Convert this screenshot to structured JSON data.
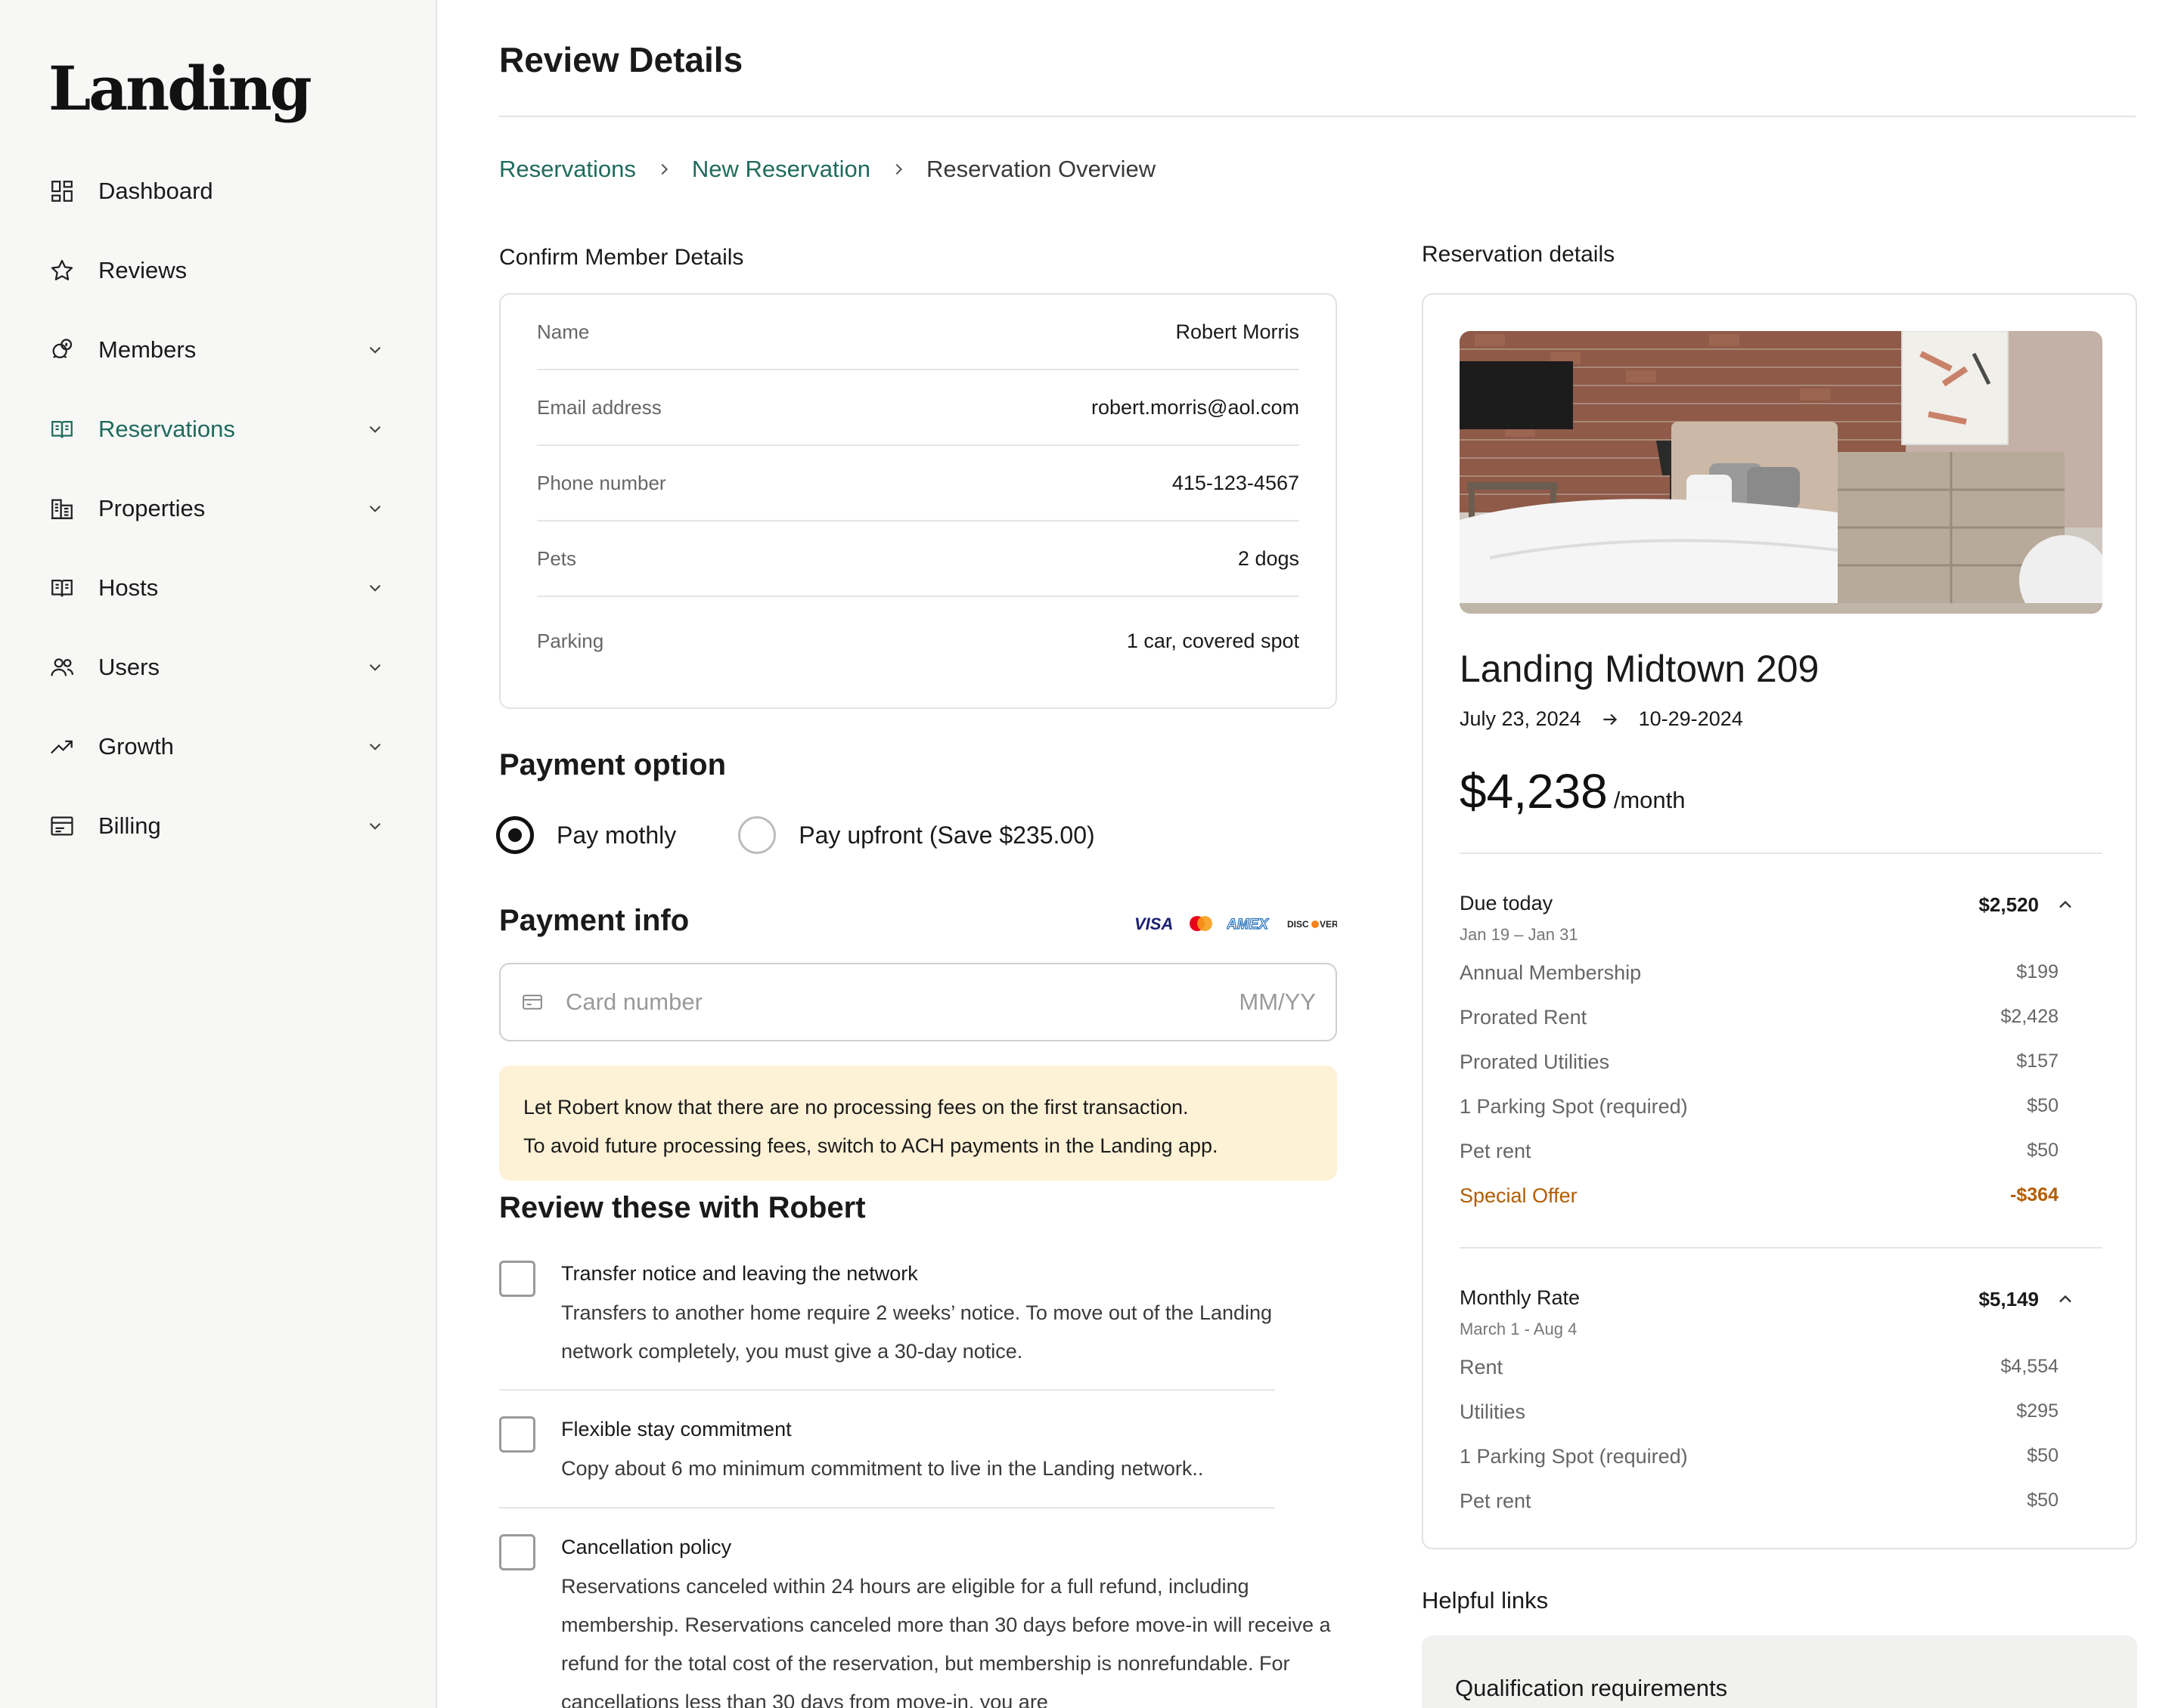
{
  "brand": {
    "logo_text": "Landing"
  },
  "sidebar": {
    "items": [
      {
        "label": "Dashboard",
        "icon": "dashboard-icon",
        "has_chevron": false,
        "active": false
      },
      {
        "label": "Reviews",
        "icon": "star-icon",
        "has_chevron": false,
        "active": false
      },
      {
        "label": "Members",
        "icon": "members-icon",
        "has_chevron": true,
        "active": false
      },
      {
        "label": "Reservations",
        "icon": "reservations-icon",
        "has_chevron": true,
        "active": true
      },
      {
        "label": "Properties",
        "icon": "building-icon",
        "has_chevron": true,
        "active": false
      },
      {
        "label": "Hosts",
        "icon": "hosts-icon",
        "has_chevron": true,
        "active": false
      },
      {
        "label": "Users",
        "icon": "users-icon",
        "has_chevron": true,
        "active": false
      },
      {
        "label": "Growth",
        "icon": "trend-icon",
        "has_chevron": true,
        "active": false
      },
      {
        "label": "Billing",
        "icon": "billing-icon",
        "has_chevron": true,
        "active": false
      }
    ]
  },
  "header": {
    "title": "Review Details"
  },
  "breadcrumb": {
    "items": [
      {
        "label": "Reservations",
        "link": true
      },
      {
        "label": "New Reservation",
        "link": true
      },
      {
        "label": "Reservation Overview",
        "link": false
      }
    ]
  },
  "member": {
    "section_title": "Confirm Member Details",
    "rows": [
      {
        "key": "Name",
        "value": "Robert Morris"
      },
      {
        "key": "Email address",
        "value": "robert.morris@aol.com"
      },
      {
        "key": "Phone number",
        "value": "415-123-4567"
      },
      {
        "key": "Pets",
        "value": "2 dogs"
      },
      {
        "key": "Parking",
        "value": "1 car, covered spot"
      }
    ]
  },
  "payment_option": {
    "title": "Payment option",
    "options": [
      {
        "label": "Pay mothly",
        "selected": true
      },
      {
        "label": "Pay upfront (Save $235.00)",
        "selected": false
      }
    ]
  },
  "payment_info": {
    "title": "Payment info",
    "brands": [
      "VISA",
      "MASTERCARD",
      "AMEX",
      "DISCOVER"
    ],
    "card_placeholder": "Card number",
    "expiry_placeholder": "MM/YY",
    "notice_line1": "Let Robert know that there are no processing fees on the first transaction.",
    "notice_line2": "To avoid future processing fees, switch to ACH payments in the Landing app."
  },
  "review": {
    "title": "Review these with Robert",
    "items": [
      {
        "title": "Transfer notice and leaving the network",
        "desc": "Transfers to another home require 2 weeks’ notice. To move out of the Landing network completely, you must give a 30-day notice.",
        "checked": false
      },
      {
        "title": "Flexible stay commitment",
        "desc": "Copy about 6 mo minimum commitment to live in the Landing network..",
        "checked": false
      },
      {
        "title": "Cancellation policy",
        "desc": "Reservations canceled within 24 hours are eligible for a full refund, including membership. Reservations canceled more than 30 days before move-in will receive a refund for the total cost of the reservation, but membership is nonrefundable. For cancellations less than 30 days from move-in, you are",
        "checked": false
      }
    ]
  },
  "reservation": {
    "section_title": "Reservation details",
    "property_name": "Landing Midtown 209",
    "start_date": "July 23, 2024",
    "end_date": "10-29-2024",
    "price": "$4,238",
    "price_unit": "/month",
    "due_today": {
      "title": "Due today",
      "range": "Jan 19 – Jan 31",
      "total": "$2,520",
      "lines": [
        {
          "label": "Annual Membership",
          "amount": "$199"
        },
        {
          "label": "Prorated Rent",
          "amount": "$2,428"
        },
        {
          "label": "Prorated Utilities",
          "amount": "$157"
        },
        {
          "label": "1 Parking Spot (required)",
          "amount": "$50"
        },
        {
          "label": "Pet rent",
          "amount": "$50"
        },
        {
          "label": "Special Offer",
          "amount": "-$364"
        }
      ]
    },
    "monthly": {
      "title": "Monthly Rate",
      "range": "March 1 - Aug 4",
      "total": "$5,149",
      "lines": [
        {
          "label": "Rent",
          "amount": "$4,554"
        },
        {
          "label": "Utilities",
          "amount": "$295"
        },
        {
          "label": "1 Parking Spot (required)",
          "amount": "$50"
        },
        {
          "label": "Pet rent",
          "amount": "$50"
        }
      ]
    }
  },
  "helpful": {
    "title": "Helpful links",
    "links": [
      {
        "label": "Qualification requirements"
      }
    ]
  },
  "colors": {
    "accent": "#1f6b5c",
    "notice_bg": "#fdf1d6",
    "offer": "#b35c00",
    "sidebar_bg": "#f7f7f6"
  }
}
